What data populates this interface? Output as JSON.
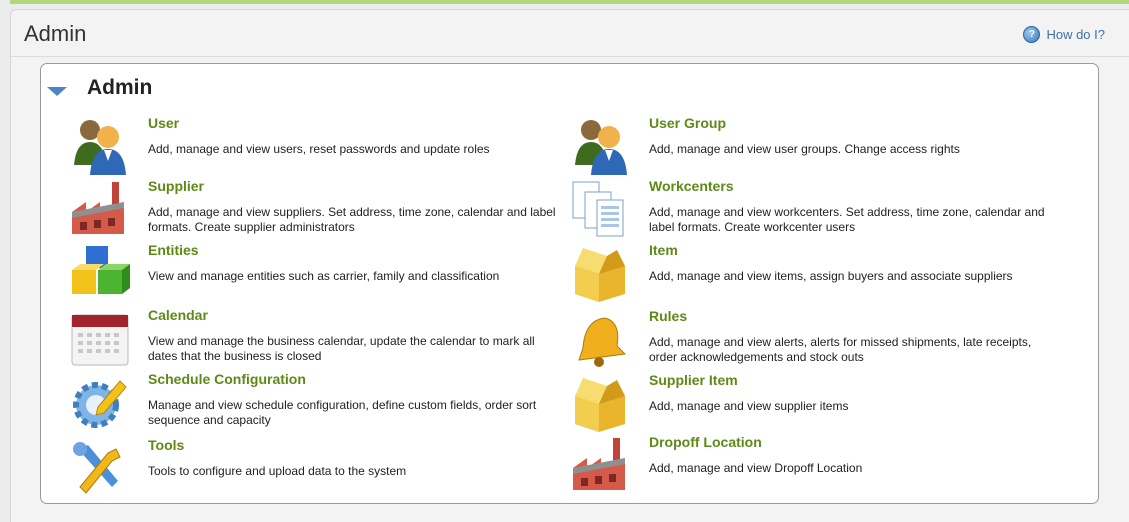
{
  "page": {
    "title": "Admin",
    "help_label": "How do I?"
  },
  "section": {
    "title": "Admin"
  },
  "items": [
    {
      "title": "User",
      "description": "Add, manage and view users, reset passwords and update roles",
      "icon": "user-icon"
    },
    {
      "title": "User Group",
      "description": "Add, manage and view user groups. Change access rights",
      "icon": "user-group-icon"
    },
    {
      "title": "Supplier",
      "description": "Add, manage and view suppliers. Set address, time zone, calendar and label formats. Create supplier administrators",
      "icon": "factory-icon"
    },
    {
      "title": "Workcenters",
      "description": "Add, manage and view workcenters. Set address, time zone, calendar and label formats. Create workcenter users",
      "icon": "forms-icon"
    },
    {
      "title": "Entities",
      "description": "View and manage entities such as carrier, family and classification",
      "icon": "cubes-icon"
    },
    {
      "title": "Item",
      "description": "Add, manage and view items, assign buyers and associate suppliers",
      "icon": "box-icon"
    },
    {
      "title": "Calendar",
      "description": "View and manage the business calendar, update the calendar to mark all dates that the business is closed",
      "icon": "calendar-icon"
    },
    {
      "title": "Rules",
      "description": "Add, manage and view alerts, alerts for missed shipments, late receipts, order acknowledgements and stock outs",
      "icon": "bell-icon"
    },
    {
      "title": "Schedule Configuration",
      "description": "Manage and view schedule configuration, define custom fields, order sort sequence and capacity",
      "icon": "gear-pencil-icon"
    },
    {
      "title": "Supplier Item",
      "description": "Add, manage and view supplier items",
      "icon": "box-icon"
    },
    {
      "title": "Tools",
      "description": "Tools to configure and upload data to the system",
      "icon": "tools-icon"
    },
    {
      "title": "Dropoff Location",
      "description": "Add, manage and view Dropoff Location",
      "icon": "factory-icon"
    }
  ],
  "colors": {
    "link_green": "#5d8a16",
    "help_blue": "#3e70a5",
    "accent_green": "#b4d77a"
  }
}
